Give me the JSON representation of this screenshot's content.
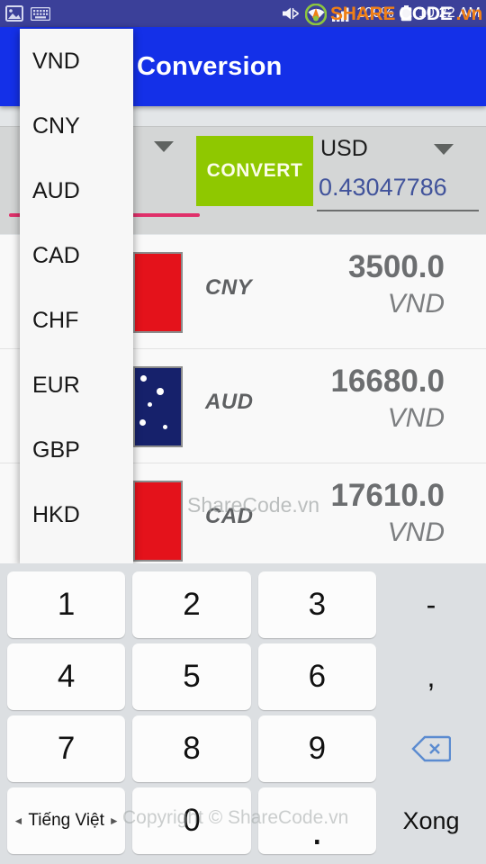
{
  "statusbar": {
    "left_icons": [
      "image-icon",
      "keyboard-icon"
    ],
    "right_icons": [
      "mute-icon",
      "wifi-icon",
      "signal-icon",
      "battery-icon"
    ],
    "battery": "100%",
    "time": "10:22 AM"
  },
  "appbar": {
    "title": "Conversion"
  },
  "converter": {
    "source": {
      "value": "",
      "caret": "chevron-down-icon"
    },
    "convert_label": "CONVERT",
    "dest": {
      "code": "USD",
      "value": "0.43047786",
      "caret": "chevron-down-icon"
    }
  },
  "dropdown": {
    "items": [
      {
        "label": "VND"
      },
      {
        "label": "CNY"
      },
      {
        "label": "AUD"
      },
      {
        "label": "CAD"
      },
      {
        "label": "CHF"
      },
      {
        "label": "EUR"
      },
      {
        "label": "GBP"
      },
      {
        "label": "HKD"
      }
    ]
  },
  "list": {
    "rows": [
      {
        "code": "CNY",
        "amount": "3500.0",
        "unit": "VND",
        "flag": "flag-china"
      },
      {
        "code": "AUD",
        "amount": "16680.0",
        "unit": "VND",
        "flag": "flag-australia"
      },
      {
        "code": "CAD",
        "amount": "17610.0",
        "unit": "VND",
        "flag": "flag-canada"
      }
    ]
  },
  "keyboard": {
    "rows": [
      {
        "keys": [
          {
            "label": "1",
            "style": "key"
          },
          {
            "label": "2",
            "style": "key"
          },
          {
            "label": "3",
            "style": "key"
          },
          {
            "label": "-",
            "style": "flat"
          }
        ]
      },
      {
        "keys": [
          {
            "label": "4",
            "style": "key"
          },
          {
            "label": "5",
            "style": "key"
          },
          {
            "label": "6",
            "style": "key"
          },
          {
            "label": ",",
            "style": "flat"
          }
        ]
      },
      {
        "keys": [
          {
            "label": "7",
            "style": "key"
          },
          {
            "label": "8",
            "style": "key"
          },
          {
            "label": "9",
            "style": "key"
          },
          {
            "label": "",
            "style": "flat",
            "icon": "backspace-icon"
          }
        ]
      },
      {
        "keys": [
          {
            "label": "Tiếng Việt",
            "style": "lang",
            "left_arrow": "◄",
            "right_arrow": "►"
          },
          {
            "label": "0",
            "style": "key"
          },
          {
            "label": ".",
            "style": "key"
          },
          {
            "label": "Xong",
            "style": "done"
          }
        ]
      }
    ]
  },
  "watermark": {
    "middle": "ShareCode.vn",
    "bottom": "Copyright © ShareCode.vn",
    "logo_share": "SHARE",
    "logo_code": "CODE",
    "logo_vn": ".vn",
    "brand_orange": "#f07f16",
    "brand_green": "#8cc63f"
  },
  "colors": {
    "appbar": "#1430e8",
    "statusbar": "#3b4099",
    "convert_button": "#8fc800",
    "panel": "#d4d6d6",
    "focus_underline": "#e0306a",
    "dest_value": "#41539b"
  }
}
